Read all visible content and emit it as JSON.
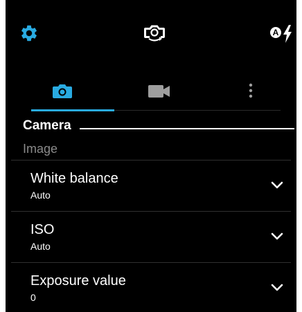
{
  "colors": {
    "accent": "#29abe2",
    "background": "#000000",
    "text": "#ffffff",
    "muted": "#8a8a8a",
    "inactive_icon": "#9e9e9e"
  },
  "top_bar": {
    "icons": [
      "gear-icon",
      "switch-camera-icon",
      "auto-flash-icon"
    ],
    "flash_badge": "A"
  },
  "tabs": [
    {
      "icon": "camera-icon",
      "selected": true
    },
    {
      "icon": "video-icon",
      "selected": false
    },
    {
      "icon": "more-vertical-icon",
      "selected": false
    }
  ],
  "section": {
    "title": "Camera",
    "category": "Image"
  },
  "settings": [
    {
      "label": "White balance",
      "value": "Auto",
      "icon": "chevron-down-icon"
    },
    {
      "label": "ISO",
      "value": "Auto",
      "icon": "chevron-down-icon"
    },
    {
      "label": "Exposure value",
      "value": "0",
      "icon": "chevron-down-icon"
    }
  ]
}
